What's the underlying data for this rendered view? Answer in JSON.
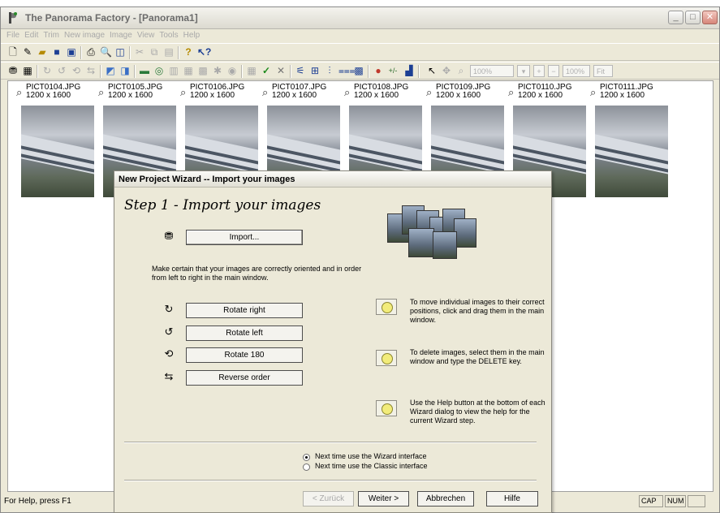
{
  "window": {
    "title": "The Panorama Factory - [Panorama1]",
    "controls": [
      "minimize-icon",
      "maximize-icon",
      "close-icon"
    ]
  },
  "menu": [
    "File",
    "Edit",
    "Trim",
    "New image",
    "Image",
    "View",
    "Tools",
    "Help"
  ],
  "toolbar": {
    "zoom1": "100%",
    "zoom2": "100%",
    "fit_label": "Fit"
  },
  "thumbnails": [
    {
      "name": "PICT0104.JPG",
      "size": "1200 x 1600"
    },
    {
      "name": "PICT0105.JPG",
      "size": "1200 x 1600"
    },
    {
      "name": "PICT0106.JPG",
      "size": "1200 x 1600"
    },
    {
      "name": "PICT0107.JPG",
      "size": "1200 x 1600"
    },
    {
      "name": "PICT0108.JPG",
      "size": "1200 x 1600"
    },
    {
      "name": "PICT0109.JPG",
      "size": "1200 x 1600"
    },
    {
      "name": "PICT0110.JPG",
      "size": "1200 x 1600"
    },
    {
      "name": "PICT0111.JPG",
      "size": "1200 x 1600"
    }
  ],
  "status": {
    "help": "For Help, press F1",
    "cap": "CAP",
    "num": "NUM"
  },
  "wizard": {
    "title": "New Project Wizard -- Import your images",
    "step": "Step 1 - Import your images",
    "import_label": "Import...",
    "instruction": "Make certain that your images are correctly oriented and in order from left to right in the main window.",
    "rotate_right": "Rotate right",
    "rotate_left": "Rotate left",
    "rotate_180": "Rotate 180",
    "reverse": "Reverse order",
    "hint_move": "To move individual images to their correct positions, click and drag them in the main window.",
    "hint_delete": "To delete images, select them in the main window and type the DELETE key.",
    "hint_help": "Use the Help button at the bottom of each Wizard dialog to view the help for the current Wizard step.",
    "radio_wizard": "Next time use the Wizard interface",
    "radio_classic": "Next time use the Classic interface",
    "radio_selected": "wizard",
    "back": "< Zurück",
    "next": "Weiter >",
    "cancel": "Abbrechen",
    "help": "Hilfe"
  }
}
